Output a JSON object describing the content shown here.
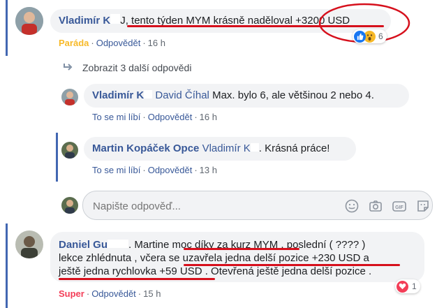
{
  "comment1": {
    "author": "Vladimír K",
    "author_tail": "J",
    "text": ", tento týden MYM krásně naděloval ",
    "highlight": "+3200 USD",
    "reaction_label": "Paráda",
    "reply_action": "Odpovědět",
    "time": "16 h",
    "reaction_count": "6"
  },
  "more_replies": {
    "label": "Zobrazit 3 další odpovědi"
  },
  "reply1": {
    "author": "Vladimír K",
    "mention": "David Číhal",
    "text": " Max. bylo 6, ale většinou 2 nebo 4.",
    "like_action": "To se mi líbí",
    "reply_action": "Odpovědět",
    "time": "16 h"
  },
  "reply2": {
    "author": "Martin Kopáček Opce",
    "mention": "Vladimír K",
    "text": ". Krásná práce!",
    "like_action": "To se mi líbí",
    "reply_action": "Odpovědět",
    "time": "13 h"
  },
  "reply_box": {
    "placeholder": "Napište odpověď..."
  },
  "comment2": {
    "author": "Daniel Gu",
    "line1_a": ". Martine ",
    "line1_b": "moc díky za kurz MYM",
    "line1_c": " , poslední ( ???? )",
    "line2_a": "lekce zhlédnuta , včera se ",
    "line2_b": "uzavřela jedna delší pozice +230 USD a",
    "line3_a": "ještě jedna rychlovka +59 USD",
    "line3_b": " . Otevřená ještě jedna delší pozice .",
    "reaction_label": "Super",
    "reply_action": "Odpovědět",
    "time": "15 h",
    "reaction_count": "1"
  },
  "colors": {
    "link": "#385898",
    "paráda": "#f7b928",
    "super": "#f33e58",
    "annotation": "#d6101c",
    "thread_line": "#4267b2"
  }
}
